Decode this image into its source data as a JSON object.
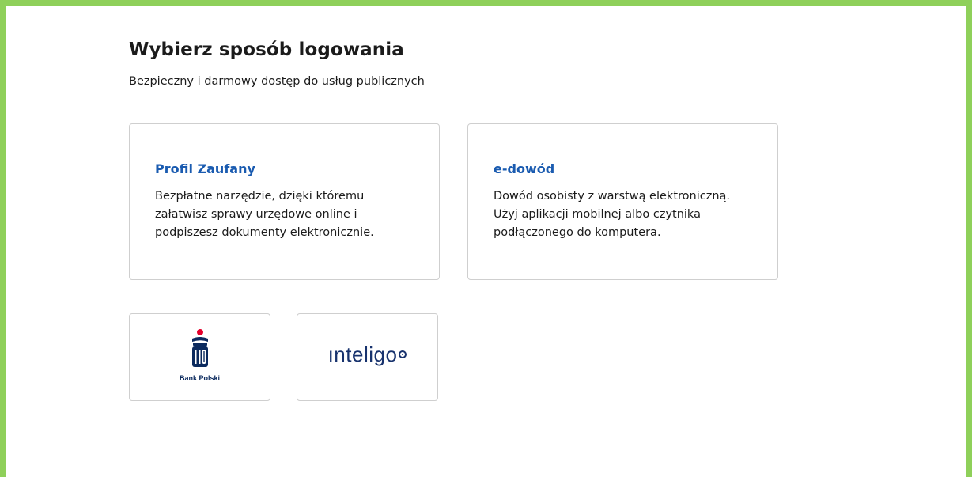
{
  "page": {
    "title": "Wybierz sposób logowania",
    "subtitle": "Bezpieczny i darmowy dostęp do usług publicznych"
  },
  "options": {
    "profil_zaufany": {
      "title": "Profil Zaufany",
      "description": "Bezpłatne narzędzie, dzięki któremu\nzałatwisz sprawy urzędowe online i\npodpiszesz dokumenty elektronicznie."
    },
    "e_dowod": {
      "title": "e-dowód",
      "description": "Dowód osobisty z warstwą elektroniczną.\nUżyj aplikacji mobilnej albo czytnika\npodłączonego do komputera."
    }
  },
  "banks": {
    "pko": {
      "logo_icon": "pko-bank-polski-logo",
      "name": "Bank Polski"
    },
    "inteligo": {
      "logo_icon": "inteligo-logo",
      "name": "ınteligo"
    }
  },
  "colors": {
    "frame_border": "#8fd05a",
    "link_blue": "#1a5bb0",
    "pko_red": "#e4002b",
    "pko_navy": "#0b2a5e",
    "inteligo_navy": "#17326d"
  }
}
